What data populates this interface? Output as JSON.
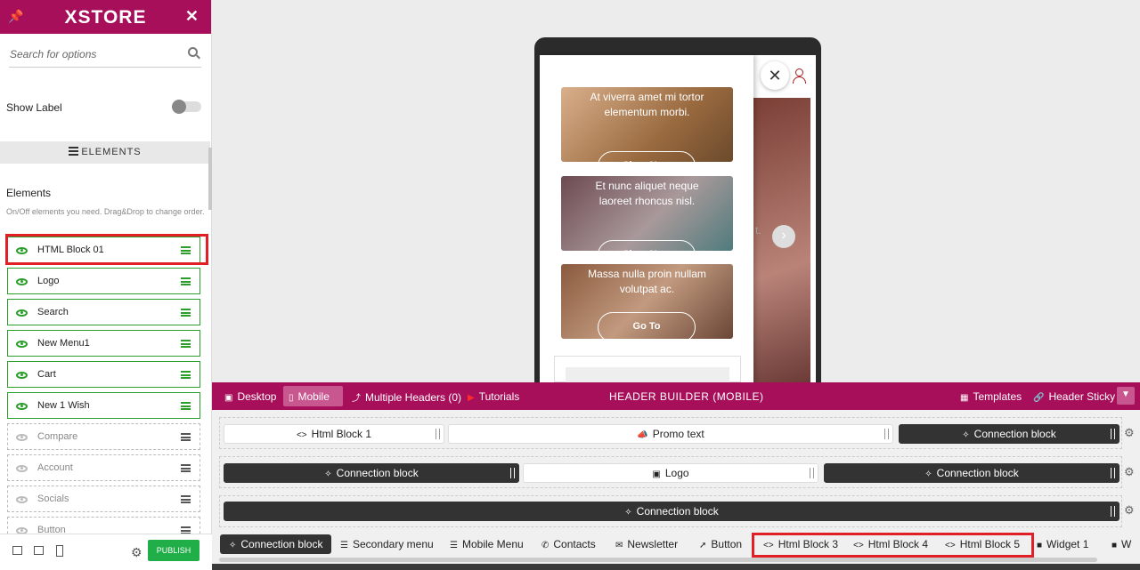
{
  "sidebar": {
    "brand": "XSTORE",
    "search_placeholder": "Search for options",
    "show_label": "Show Label",
    "elements_tab": "ELEMENTS",
    "elements_title": "Elements",
    "elements_desc": "On/Off elements you need. Drag&Drop to change order.",
    "items": [
      {
        "label": "HTML Block 01",
        "enabled": true
      },
      {
        "label": "Logo",
        "enabled": true
      },
      {
        "label": "Search",
        "enabled": true
      },
      {
        "label": "New Menu1",
        "enabled": true
      },
      {
        "label": "Cart",
        "enabled": true
      },
      {
        "label": "New 1 Wish",
        "enabled": true
      },
      {
        "label": "Compare",
        "enabled": false
      },
      {
        "label": "Account",
        "enabled": false
      },
      {
        "label": "Socials",
        "enabled": false
      },
      {
        "label": "Button",
        "enabled": false
      }
    ],
    "publish": "PUBLISH"
  },
  "preview": {
    "cards": [
      {
        "text": "At viverra amet mi tortor elementum morbi.",
        "button": "Shop Now"
      },
      {
        "text": "Et nunc aliquet neque laoreet rhoncus nisl.",
        "button": "Shop Now"
      },
      {
        "text": "Massa nulla proin nullam volutpat ac.",
        "button": "Go To"
      }
    ],
    "slider_fragment": "t."
  },
  "builder_bar": {
    "desktop": "Desktop",
    "mobile": "Mobile",
    "multiple_headers": "Multiple Headers (0)",
    "tutorials": "Tutorials",
    "title": "HEADER BUILDER (MOBILE)",
    "templates": "Templates",
    "header_sticky": "Header Sticky"
  },
  "rows": {
    "row1": {
      "left": "Html Block 1",
      "center": "Promo text",
      "right": "Connection block"
    },
    "row2": {
      "left": "Connection block",
      "center": "Logo",
      "right": "Connection block"
    },
    "row3": {
      "full": "Connection block"
    }
  },
  "pool": [
    "Connection block",
    "Secondary menu",
    "Mobile Menu",
    "Contacts",
    "Newsletter",
    "Button",
    "Html Block 3",
    "Html Block 4",
    "Html Block 5",
    "Widget 1",
    "W"
  ],
  "colors": {
    "brand": "#a70f5a",
    "active": "#2a9d2a",
    "highlight": "#e01f26",
    "publish": "#1fae48"
  }
}
